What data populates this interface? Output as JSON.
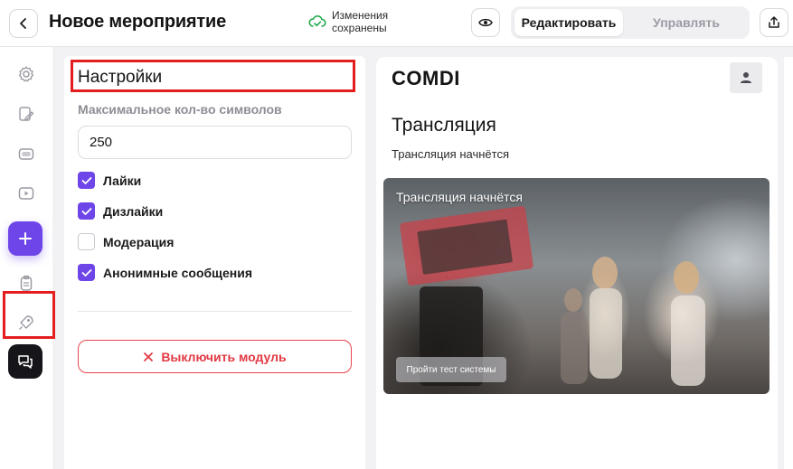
{
  "header": {
    "title": "Новое мероприятие",
    "save_status": [
      "Изменения",
      "сохранены"
    ],
    "modes": {
      "edit": "Редактировать",
      "manage": "Управлять"
    },
    "active_mode": "edit"
  },
  "rail": {
    "items": [
      "gear-icon",
      "edit-icon",
      "screen-icon",
      "play-icon",
      "add-icon",
      "clipboard-icon",
      "rocket-icon",
      "chat-icon"
    ],
    "active": "chat-icon",
    "accent": "#6d45e8"
  },
  "settings": {
    "title": "Настройки",
    "max_chars_label": "Максимальное кол-во символов",
    "max_chars_value": "250",
    "options": [
      {
        "label": "Лайки",
        "checked": true
      },
      {
        "label": "Дизлайки",
        "checked": true
      },
      {
        "label": "Модерация",
        "checked": false
      },
      {
        "label": "Анонимные сообщения",
        "checked": true
      }
    ],
    "disable_button": "Выключить модуль",
    "danger_color": "#e23a43"
  },
  "preview": {
    "brand": "COMDI",
    "stream_title": "Трансляция",
    "stream_subtitle": "Трансляция начнётся",
    "video_caption": "Трансляция начнётся",
    "test_button": "Пройти тест системы"
  },
  "highlight_color": "#e41e1e"
}
